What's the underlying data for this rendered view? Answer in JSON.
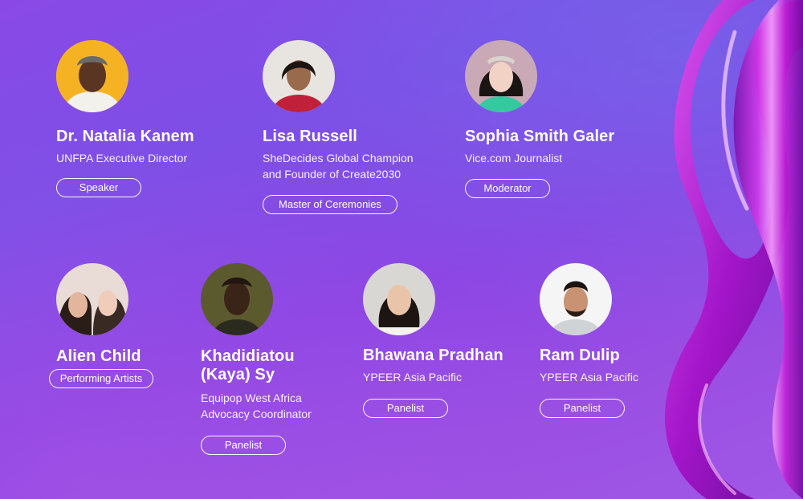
{
  "people": [
    {
      "name": "Dr. Natalia Kanem",
      "role": [
        "UNFPA Executive Director"
      ],
      "badge": "Speaker"
    },
    {
      "name": "Lisa Russell",
      "role": [
        "SheDecides Global Champion",
        "and Founder of Create2030"
      ],
      "badge": "Master of Ceremonies"
    },
    {
      "name": "Sophia Smith Galer",
      "role": [
        "Vice.com Journalist"
      ],
      "badge": "Moderator"
    },
    {
      "name": "Alien Child",
      "role": [],
      "badge": "Performing Artists"
    },
    {
      "name": [
        "Khadidiatou",
        "(Kaya) Sy"
      ],
      "role": [
        "Equipop West Africa",
        "Advocacy Coordinator"
      ],
      "badge": "Panelist"
    },
    {
      "name": "Bhawana Pradhan",
      "role": [
        "YPEER Asia Pacific"
      ],
      "badge": "Panelist"
    },
    {
      "name": "Ram Dulip",
      "role": [
        "YPEER Asia Pacific"
      ],
      "badge": "Panelist"
    }
  ],
  "colors": {
    "background": "#8a49e6",
    "ribbon": "#c21fd8",
    "text": "#ffffff"
  },
  "decoration": {
    "ribbon_icon": "infinity-ribbon-graphic"
  }
}
